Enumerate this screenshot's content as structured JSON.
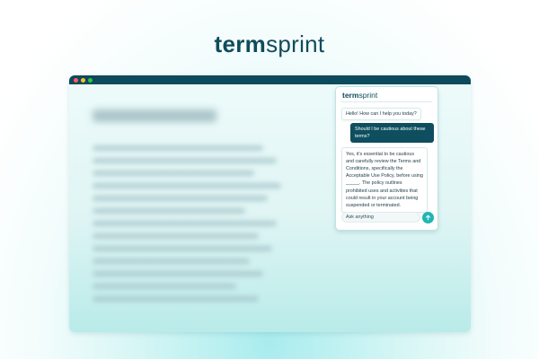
{
  "brand": {
    "bold": "term",
    "light": "sprint"
  },
  "window": {
    "dots": [
      {
        "name": "close-dot",
        "color": "#ff5f56"
      },
      {
        "name": "minimize-dot",
        "color": "#ffbd2e"
      },
      {
        "name": "maximize-dot",
        "color": "#27c93f"
      }
    ]
  },
  "chat": {
    "logo_bold": "term",
    "logo_light": "sprint",
    "greeting": "Hello! How can I help you today?",
    "user_message": "Should I be cautious about these terms?",
    "bot_answer": "Yes, it's essential to be cautious and carefully review the Terms and Conditions, specifically the Acceptable Use Policy, before using _____. The policy outlines prohibited uses and activities that could result in your account being suspended or terminated.",
    "input_placeholder": "Ask anything"
  },
  "colors": {
    "brand": "#0f4c5c",
    "accent": "#1fb6b3",
    "user_bubble": "#0e4e5f"
  },
  "icons": {
    "send": "arrow-up-icon"
  }
}
